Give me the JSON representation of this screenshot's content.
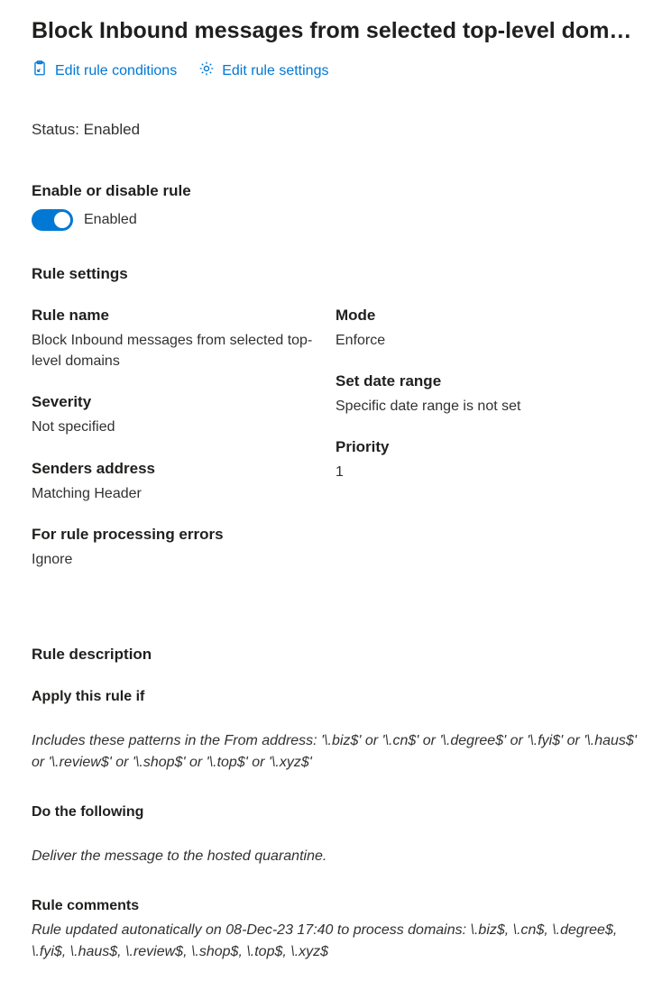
{
  "title": "Block Inbound messages from selected top-level dom…",
  "actions": {
    "edit_conditions": "Edit rule conditions",
    "edit_settings": "Edit rule settings"
  },
  "status_line": "Status: Enabled",
  "enable_disable": {
    "heading": "Enable or disable rule",
    "toggle_state": "on",
    "toggle_label": "Enabled"
  },
  "settings": {
    "heading": "Rule settings",
    "left": [
      {
        "label": "Rule name",
        "value": "Block Inbound messages from selected top-level domains"
      },
      {
        "label": "Severity",
        "value": "Not specified"
      },
      {
        "label": "Senders address",
        "value": "Matching Header"
      },
      {
        "label": "For rule processing errors",
        "value": "Ignore"
      }
    ],
    "right": [
      {
        "label": "Mode",
        "value": "Enforce"
      },
      {
        "label": "Set date range",
        "value": "Specific date range is not set"
      },
      {
        "label": "Priority",
        "value": "1"
      }
    ]
  },
  "description": {
    "heading": "Rule description",
    "apply_if": {
      "label": "Apply this rule if",
      "text": "Includes these patterns in the From address: '\\.biz$' or '\\.cn$' or '\\.degree$' or '\\.fyi$' or '\\.haus$' or '\\.review$' or '\\.shop$' or '\\.top$' or '\\.xyz$'"
    },
    "do_following": {
      "label": "Do the following",
      "text": "Deliver the message to the hosted quarantine."
    },
    "comments": {
      "label": "Rule comments",
      "text": "Rule updated autonatically on 08-Dec-23 17:40 to process domains: \\.biz$, \\.cn$, \\.degree$, \\.fyi$, \\.haus$, \\.review$, \\.shop$, \\.top$, \\.xyz$"
    }
  }
}
